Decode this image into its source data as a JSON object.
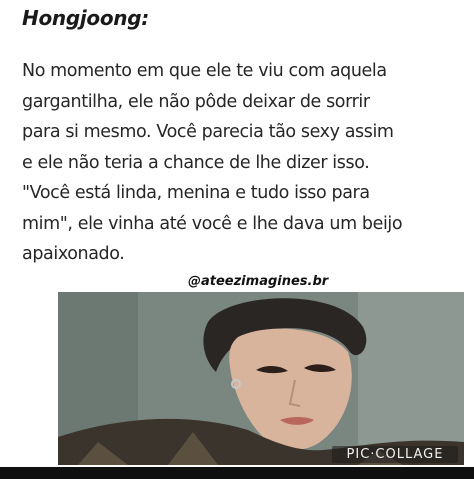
{
  "post": {
    "title": "Hongjoong:",
    "lines": [
      "No momento em que ele te viu com aquela",
      "gargantilha, ele não pôde deixar de sorrir",
      "para si mesmo. Você parecia tão sexy assim",
      "e ele não teria a chance de lhe dizer isso.",
      "\"Você está linda, menina e tudo isso para",
      "mim\", ele vinha até você e lhe dava um beijo",
      "apaixonado."
    ],
    "watermark": "@ateezimagines.br"
  },
  "photo": {
    "badge": "PIC·COLLAGE"
  },
  "colors": {
    "background": "#ffffff",
    "text": "#262626",
    "bottom_bar": "#0f0f0f"
  }
}
